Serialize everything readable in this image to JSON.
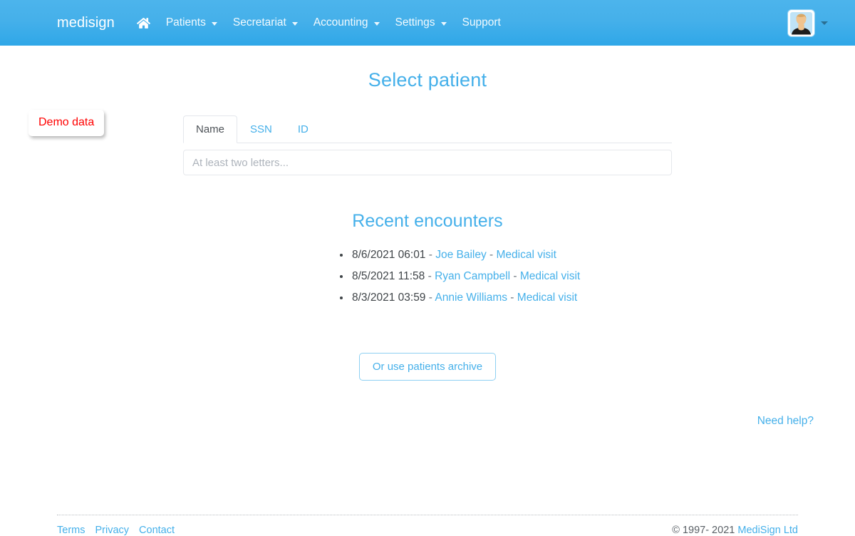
{
  "navbar": {
    "brand": "medisign",
    "home_icon": "home-icon",
    "items": [
      {
        "label": "Patients",
        "has_caret": true
      },
      {
        "label": "Secretariat",
        "has_caret": true
      },
      {
        "label": "Accounting",
        "has_caret": true
      },
      {
        "label": "Settings",
        "has_caret": true
      },
      {
        "label": "Support",
        "has_caret": false
      }
    ],
    "avatar_icon": "user-avatar-icon",
    "user_caret_icon": "chevron-down-icon",
    "background_color": "#45b0ea"
  },
  "demo_badge": {
    "label": "Demo data",
    "color": "#ff0000"
  },
  "main": {
    "page_title": "Select patient",
    "search": {
      "tabs": [
        {
          "label": "Name",
          "active": true
        },
        {
          "label": "SSN",
          "active": false
        },
        {
          "label": "ID",
          "active": false
        }
      ],
      "input_value": "",
      "placeholder": "At least two letters..."
    },
    "recent": {
      "title": "Recent encounters",
      "items": [
        {
          "datetime": "8/6/2021 06:01",
          "sep1": " - ",
          "patient": "Joe Bailey",
          "sep2": " - ",
          "type": "Medical visit"
        },
        {
          "datetime": "8/5/2021 11:58",
          "sep1": " - ",
          "patient": "Ryan Campbell",
          "sep2": " - ",
          "type": "Medical visit"
        },
        {
          "datetime": "8/3/2021 03:59",
          "sep1": " - ",
          "patient": "Annie Williams",
          "sep2": " - ",
          "type": "Medical visit"
        }
      ]
    },
    "archive_button": "Or use patients archive",
    "help_link": "Need help?"
  },
  "footer": {
    "links": [
      "Terms",
      "Privacy",
      "Contact"
    ],
    "copyright_text": "© 1997- 2021 ",
    "company": "MediSign Ltd"
  },
  "accent_color": "#45b0ea"
}
